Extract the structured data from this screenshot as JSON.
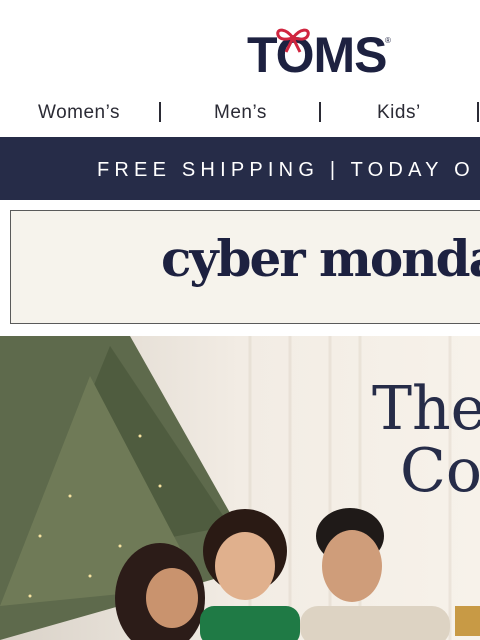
{
  "brand": {
    "logo_text": "TOMS"
  },
  "nav": {
    "items": [
      "Women’s",
      "Men’s",
      "Kids’"
    ]
  },
  "banner": {
    "text": "FREE SHIPPING | TODAY O"
  },
  "promo": {
    "title": "cyber monday"
  },
  "hero": {
    "line1": "The C",
    "line2": "Con"
  },
  "colors": {
    "navy": "#262c48",
    "bow_red": "#d0253f",
    "cream": "#f6f3ec"
  }
}
